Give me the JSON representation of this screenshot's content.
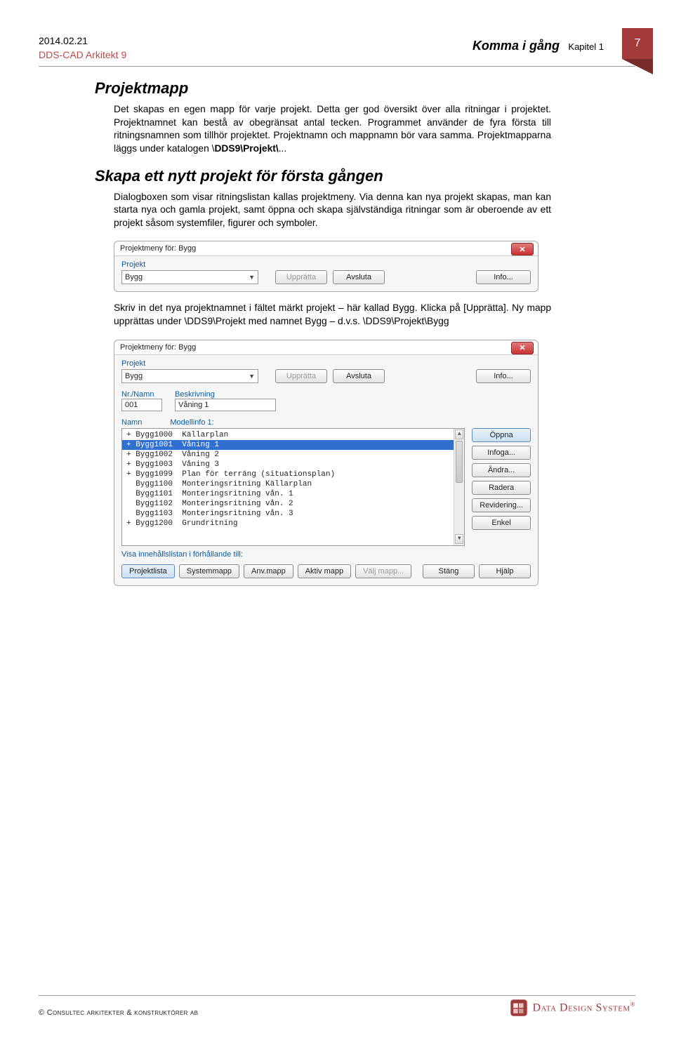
{
  "header": {
    "date": "2014.02.21",
    "subtitle": "DDS-CAD Arkitekt 9",
    "right_title": "Komma i gång",
    "chapter": "Kapitel 1",
    "page_num": "7"
  },
  "section1": {
    "title": "Projektmapp",
    "para_a": "Det skapas en egen mapp för varje projekt. Detta ger god översikt över alla ritningar i projektet. Projektnamnet kan bestå av obegränsat antal tecken. Programmet använder de fyra första till ritningsnamnen som tillhör projektet. Projektnamn och mappnamn bör vara samma. Projektmapparna läggs under katalogen \\",
    "para_bold": "DDS9\\Projekt\\",
    "para_b": "..."
  },
  "section2": {
    "title": "Skapa ett nytt projekt för första gången",
    "para": "Dialogboxen som visar ritningslistan kallas projektmeny. Via denna kan nya projekt skapas, man kan starta nya och gamla projekt, samt öppna och skapa självständiga ritningar som är oberoende av ett projekt såsom systemfiler, figurer och symboler."
  },
  "dlg1": {
    "title": "Projektmeny för: Bygg",
    "lbl_projekt": "Projekt",
    "combo_value": "Bygg",
    "btn_uppratta": "Upprätta",
    "btn_avsluta": "Avsluta",
    "btn_info": "Info..."
  },
  "para_mid": "Skriv in det nya projektnamnet i fältet märkt projekt – här kallad Bygg. Klicka på [Upprätta]. Ny mapp upprättas under \\DDS9\\Projekt med namnet Bygg – d.v.s. \\DDS9\\Projekt\\Bygg",
  "dlg2": {
    "title": "Projektmeny för: Bygg",
    "lbl_projekt": "Projekt",
    "combo_value": "Bygg",
    "btn_uppratta": "Upprätta",
    "btn_avsluta": "Avsluta",
    "btn_info": "Info...",
    "lbl_nr": "Nr./Namn",
    "lbl_beskr": "Beskrivning",
    "nr_value": "001",
    "beskr_value": "Våning 1",
    "lbl_namn": "Namn",
    "lbl_model": "Modellinfo 1:",
    "list": [
      "+ Bygg1000  Källarplan",
      "+ Bygg1001  Våning 1",
      "+ Bygg1002  Våning 2",
      "+ Bygg1003  Våning 3",
      "+ Bygg1099  Plan för terräng (situationsplan)",
      "  Bygg1100  Monteringsritning Källarplan",
      "  Bygg1101  Monteringsritning vån. 1",
      "  Bygg1102  Monteringsritning vån. 2",
      "  Bygg1103  Monteringsritning vån. 3",
      "+ Bygg1200  Grundritning"
    ],
    "list_selected_index": 1,
    "btn_oppna": "Öppna",
    "btn_infoga": "Infoga...",
    "btn_andra": "Ändra...",
    "btn_radera": "Radera",
    "btn_revid": "Revidering...",
    "btn_enkel": "Enkel",
    "lbl_visa": "Visa innehållslistan i förhållande till:",
    "tg_projektlista": "Projektlista",
    "tg_systemmapp": "Systemmapp",
    "tg_anvmapp": "Anv.mapp",
    "tg_aktivmapp": "Aktiv mapp",
    "tg_valjmapp": "Välj mapp...",
    "btn_stang": "Stäng",
    "btn_hjalp": "Hjälp"
  },
  "footer": {
    "left": "© Consultec arkitekter & konstruktörer ab",
    "brand": "Data Design System",
    "reg": "®"
  }
}
